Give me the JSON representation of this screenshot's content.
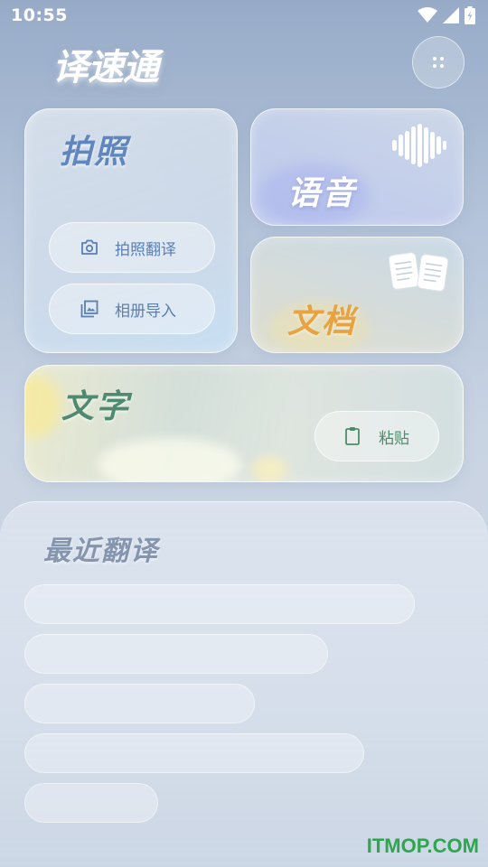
{
  "status_bar": {
    "time": "10:55"
  },
  "app": {
    "title": "译速通"
  },
  "cards": {
    "photo": {
      "title": "拍照",
      "take_photo_label": "拍照翻译",
      "album_import_label": "相册导入"
    },
    "voice": {
      "title": "语音"
    },
    "document": {
      "title": "文档"
    },
    "text": {
      "title": "文字",
      "paste_label": "粘贴"
    }
  },
  "recent": {
    "title": "最近翻译",
    "placeholder_count": 5
  },
  "watermark": {
    "text": "ITMOP.COM"
  },
  "colors": {
    "photo_title": "#5f86bf",
    "doc_title": "#e8a240",
    "text_title": "#4f8a70",
    "watermark": "#2ea64d"
  },
  "icons": [
    "wifi-icon",
    "signal-icon",
    "battery-icon",
    "more-icon",
    "camera-icon",
    "image-icon",
    "clipboard-icon",
    "waveform-icon",
    "book-icon"
  ]
}
